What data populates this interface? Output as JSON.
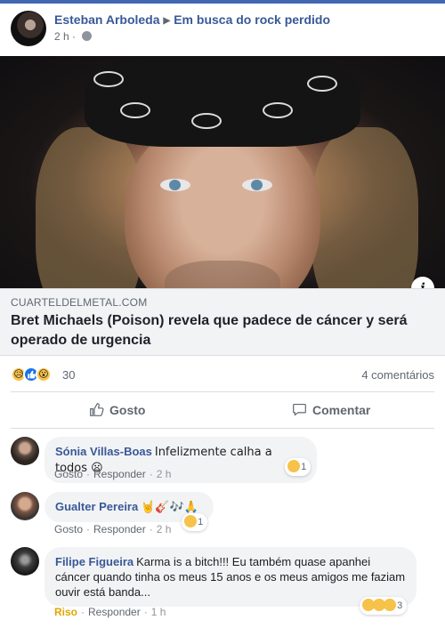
{
  "post": {
    "author": "Esteban Arboleda",
    "group": "Em busca do rock perdido",
    "time": "2 h",
    "link": {
      "source": "CUARTELDELMETAL.COM",
      "title": "Bret Michaels (Poison) revela que padece de cáncer y será operado de urgencia"
    },
    "reactions_count": "30",
    "comments_count": "4 comentários",
    "actions": {
      "like": "Gosto",
      "comment": "Comentar"
    }
  },
  "comments": [
    {
      "name": "Sónia Villas-Boas",
      "text": "Infelizmente calha a todos 😦",
      "like_label": "Gosto",
      "reply_label": "Responder",
      "time": "2 h",
      "reaction_count": "1"
    },
    {
      "name": "Gualter Pereira",
      "text": "🤘🎸🎶🙏",
      "like_label": "Gosto",
      "reply_label": "Responder",
      "time": "2 h",
      "reaction_count": "1"
    },
    {
      "name": "Filipe Figueira",
      "text": "Karma is a bitch!!! Eu também quase apanhei cáncer quando tinha os meus 15 anos e os meus amigos me faziam ouvir está banda...",
      "like_label": "Riso",
      "reply_label": "Responder",
      "time": "1 h",
      "reaction_count": "3"
    }
  ],
  "colors": {
    "name_blue": "#385898",
    "like_blue": "#1b74e4",
    "riso_yellow": "#e1a400",
    "bubble_gray": "#f2f3f5"
  },
  "icons": [
    "globe-icon",
    "info-icon",
    "thumbs-up-icon",
    "comment-icon",
    "sad-reaction-icon",
    "like-reaction-icon",
    "wow-reaction-icon"
  ]
}
